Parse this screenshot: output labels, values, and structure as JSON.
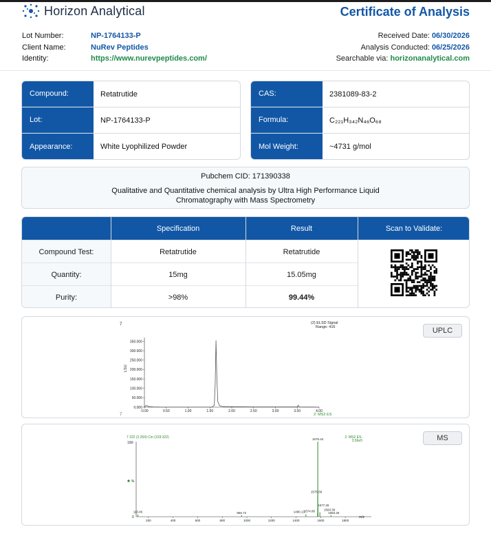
{
  "header": {
    "brand": "Horizon Analytical",
    "doc_title": "Certificate of Analysis"
  },
  "meta_left": [
    {
      "label": "Lot Number:",
      "value": "NP-1764133-P"
    },
    {
      "label": "Client Name:",
      "value": "NuRev Peptides"
    },
    {
      "label": "Identity:",
      "value": "https://www.nurevpeptides.com/"
    }
  ],
  "meta_right": [
    {
      "label": "Received Date:",
      "value": "06/30/2026"
    },
    {
      "label": "Analysis Conducted:",
      "value": "06/25/2026"
    },
    {
      "label": "Searchable via:",
      "value": "horizonanalytical.com"
    }
  ],
  "compound_card": [
    {
      "label": "Compound:",
      "value": "Retatrutide"
    },
    {
      "label": "Lot:",
      "value": "NP-1764133-P"
    },
    {
      "label": "Appearance:",
      "value": "White Lyophilized Powder"
    }
  ],
  "cas_card": [
    {
      "label": "CAS:",
      "value": "2381089-83-2"
    },
    {
      "label": "Formula:",
      "value": "C₂₂₁H₃₄₂N₄₆O₆₈"
    },
    {
      "label": "Mol Weight:",
      "value": "~4731 g/mol"
    }
  ],
  "info": {
    "cid": "Pubchem CID: 171390338",
    "desc": "Qualitative and Quantitative chemical analysis by Ultra High Performance Liquid Chromatography with Mass Spectrometry"
  },
  "spec": {
    "headers": [
      "Specification",
      "Result",
      "Scan to Validate:"
    ],
    "rows": [
      {
        "label": "Compound Test:",
        "spec": "Retatrutide",
        "result": "Retatrutide"
      },
      {
        "label": "Quantity:",
        "spec": "15mg",
        "result": "15.05mg"
      },
      {
        "label": "Purity:",
        "spec": ">98%",
        "result": "99.44%"
      }
    ]
  },
  "uplc": {
    "tag": "UPLC",
    "corner_num": "7",
    "corner_num2": "7",
    "signal": "(2) ELSD Signal",
    "range": "Range: 416",
    "ylabel": "LSU",
    "xunit": "2: MS2 ES",
    "yticks": [
      "350.000",
      "300.000",
      "250.000",
      "200.000",
      "150.000",
      "100.000",
      "50.000",
      "0.000"
    ],
    "xticks": [
      "-0.00",
      "0.50",
      "1.00",
      "1.50",
      "2.00",
      "2.50",
      "3.00",
      "3.50",
      "4.00"
    ],
    "chart_data": {
      "type": "line",
      "xlim": [
        0,
        4
      ],
      "ylim": [
        0,
        370
      ],
      "peak_x": 1.64,
      "peak_y": 355
    }
  },
  "ms": {
    "tag": "MS",
    "header_left": "7 322 (2.254) Cm (319:322)",
    "header_right": "2: MS2 ES-",
    "header_right2": "3.56e5",
    "y100": "100-",
    "yzero": "0",
    "ylabel": "%",
    "xunit": "m/z",
    "xticks": [
      "200",
      "400",
      "600",
      "800",
      "1000",
      "1200",
      "1400",
      "1600",
      "1800"
    ],
    "peaks": [
      {
        "mz": 113.46,
        "label": "113.46",
        "rel": 3
      },
      {
        "mz": 956.72,
        "label": "956.72",
        "rel": 2
      },
      {
        "mz": 1480.13,
        "label": "1480.13",
        "rel": 3
      },
      {
        "mz": 1574.86,
        "label": "1574.86",
        "rel": 4
      },
      {
        "mz": 1575.58,
        "label": "1575.58",
        "rel": 30
      },
      {
        "mz": 1576.44,
        "label": "1576.44",
        "rel": 100
      },
      {
        "mz": 1577.26,
        "label": "1577.26",
        "rel": 12
      },
      {
        "mz": 1593.36,
        "label": "1593.36",
        "rel": 6
      },
      {
        "mz": 1683.25,
        "label": "1683.25",
        "rel": 2
      }
    ]
  },
  "colors": {
    "primary": "#1257a6",
    "green": "#1f8a4c"
  }
}
